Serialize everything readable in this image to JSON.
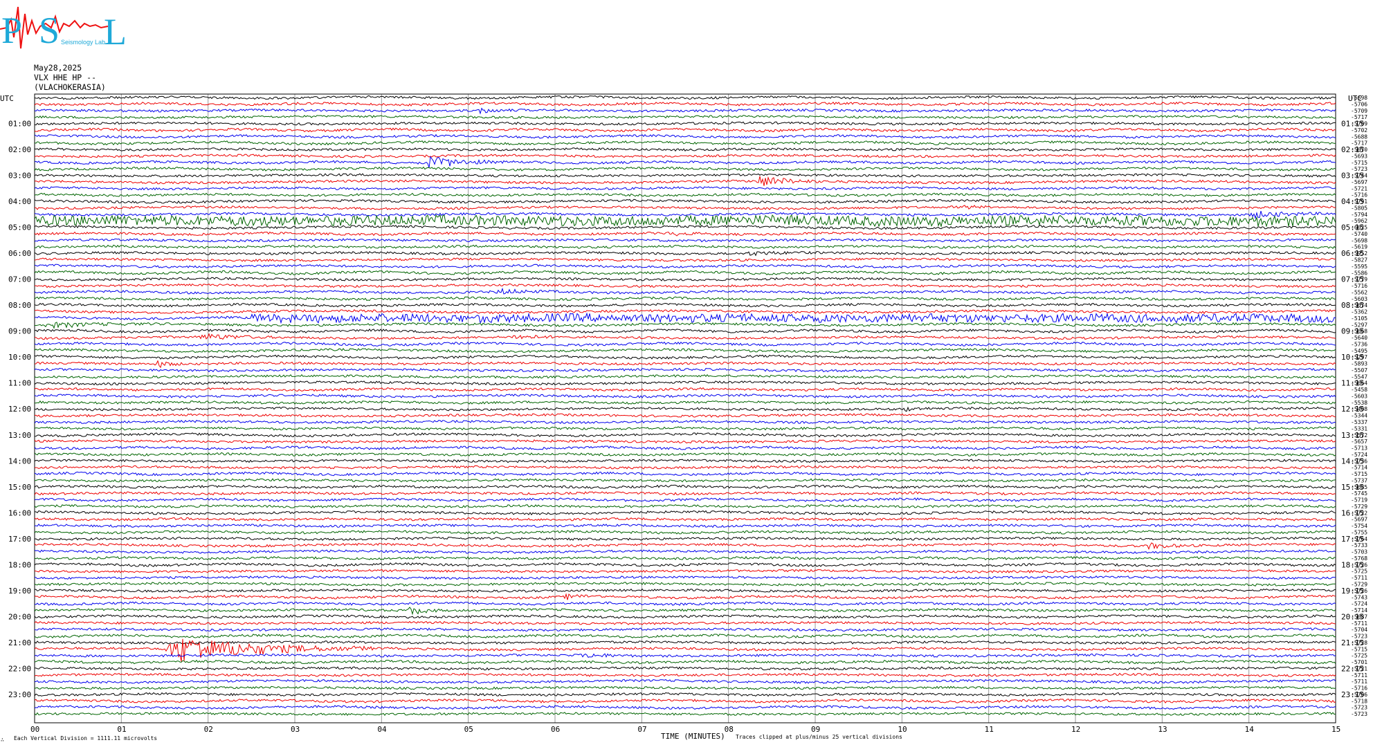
{
  "logo": {
    "text": "PSL",
    "small_text": "Seismology Lab",
    "colors": {
      "letters": "#1fa9d8",
      "trace": "#ee1111"
    }
  },
  "header": {
    "date": "May28,2025",
    "channel": "VLX HHE HP --",
    "station": "(VLACHOKERASIA)"
  },
  "chart_data": {
    "type": "line",
    "title": "",
    "utc_label": "UTC",
    "left_hour_labels": [
      "01:00",
      "02:00",
      "03:00",
      "04:00",
      "05:00",
      "06:00",
      "07:00",
      "08:00",
      "09:00",
      "10:00",
      "11:00",
      "12:00",
      "13:00",
      "14:00",
      "15:00",
      "16:00",
      "17:00",
      "18:00",
      "19:00",
      "20:00",
      "21:00",
      "22:00",
      "23:00"
    ],
    "right_hour_labels": [
      "01:15",
      "02:15",
      "03:15",
      "04:15",
      "05:15",
      "06:15",
      "07:15",
      "08:15",
      "09:15",
      "10:15",
      "11:15",
      "12:15",
      "13:15",
      "14:15",
      "15:15",
      "16:15",
      "17:15",
      "18:15",
      "19:15",
      "20:15",
      "21:15",
      "22:15",
      "23:15"
    ],
    "x_ticks": [
      "00",
      "01",
      "02",
      "03",
      "04",
      "05",
      "06",
      "07",
      "08",
      "09",
      "10",
      "11",
      "12",
      "13",
      "14",
      "15"
    ],
    "xlabel": "TIME (MINUTES)",
    "xlim": [
      0,
      15
    ],
    "trace_minutes": 15,
    "trace_count": 96,
    "trace_color_cycle": [
      "#000000",
      "#ee0000",
      "#0000ee",
      "#006400"
    ],
    "grid": true,
    "offsets": [
      "-5698",
      "-5706",
      "-5709",
      "-5717",
      "-5709",
      "-5702",
      "-5688",
      "-5717",
      "-5670",
      "-5693",
      "-5715",
      "-5723",
      "-5744",
      "-5697",
      "-5721",
      "-5716",
      "-5791",
      "-5805",
      "-5794",
      "-5962",
      "-6625",
      "-5740",
      "-5698",
      "-5619",
      "-5952",
      "-5827",
      "-5595",
      "-5586",
      "-5779",
      "-5716",
      "-5562",
      "-5603",
      "-5674",
      "-5362",
      "-5105",
      "-5297",
      "-5668",
      "-5640",
      "-5736",
      "-5495",
      "-5297",
      "-5893",
      "-5507",
      "-5547",
      "-5664",
      "-5458",
      "-5603",
      "-5538",
      "-5408",
      "-5344",
      "-5337",
      "-5331",
      "-5572",
      "-5657",
      "-5713",
      "-5724",
      "-5736",
      "-5714",
      "-5715",
      "-5737",
      "-5685",
      "-5745",
      "-5719",
      "-5729",
      "-5722",
      "-5697",
      "-5754",
      "-5755",
      "-5764",
      "-5733",
      "-5703",
      "-5768",
      "-5726",
      "-5725",
      "-5711",
      "-5729",
      "-5726",
      "-5743",
      "-5724",
      "-5714",
      "-5687",
      "-5711",
      "-5704",
      "-5723",
      "-5728",
      "-5715",
      "-5725",
      "-5701",
      "-5721",
      "-5711",
      "-5711",
      "-5716",
      "-5706",
      "-5718",
      "-5723",
      "-5723"
    ],
    "events": [
      {
        "trace": 2,
        "minute": 5.1,
        "duration": 0.5,
        "amplitude": 1.1
      },
      {
        "trace": 10,
        "minute": 4.5,
        "duration": 0.9,
        "amplitude": 2.8
      },
      {
        "trace": 13,
        "minute": 8.3,
        "duration": 0.8,
        "amplitude": 2.4
      },
      {
        "trace": 17,
        "minute": 10.7,
        "duration": 0.3,
        "amplitude": 0.8
      },
      {
        "trace": 18,
        "minute": 14.0,
        "duration": 1.0,
        "amplitude": 1.3
      },
      {
        "trace": 19,
        "minute": 0.0,
        "duration": 15.0,
        "amplitude": 1.4
      },
      {
        "trace": 21,
        "minute": 7.3,
        "duration": 0.5,
        "amplitude": 1.0
      },
      {
        "trace": 24,
        "minute": 8.2,
        "duration": 0.9,
        "amplitude": 0.7
      },
      {
        "trace": 30,
        "minute": 5.3,
        "duration": 0.8,
        "amplitude": 1.0
      },
      {
        "trace": 34,
        "minute": 2.5,
        "duration": 12.5,
        "amplitude": 1.1
      },
      {
        "trace": 35,
        "minute": 0.1,
        "duration": 1.5,
        "amplitude": 0.9
      },
      {
        "trace": 37,
        "minute": 1.9,
        "duration": 0.9,
        "amplitude": 1.3
      },
      {
        "trace": 37,
        "minute": 5.5,
        "duration": 0.6,
        "amplitude": 1.0
      },
      {
        "trace": 41,
        "minute": 1.4,
        "duration": 0.3,
        "amplitude": 1.6
      },
      {
        "trace": 48,
        "minute": 10.0,
        "duration": 0.4,
        "amplitude": 0.9
      },
      {
        "trace": 69,
        "minute": 12.8,
        "duration": 0.6,
        "amplitude": 1.2
      },
      {
        "trace": 77,
        "minute": 6.1,
        "duration": 0.5,
        "amplitude": 1.0
      },
      {
        "trace": 79,
        "minute": 4.3,
        "duration": 0.4,
        "amplitude": 2.0
      },
      {
        "trace": 85,
        "minute": 1.5,
        "duration": 2.4,
        "amplitude": 6.0
      },
      {
        "trace": 86,
        "minute": 6.3,
        "duration": 0.7,
        "amplitude": 0.9
      }
    ]
  },
  "footer": {
    "division_note": "Each Vertical Division = 1111.11 microvolts",
    "clip_note": "Traces clipped at plus/minus 25 vertical divisions",
    "corner_mark": "∴"
  }
}
